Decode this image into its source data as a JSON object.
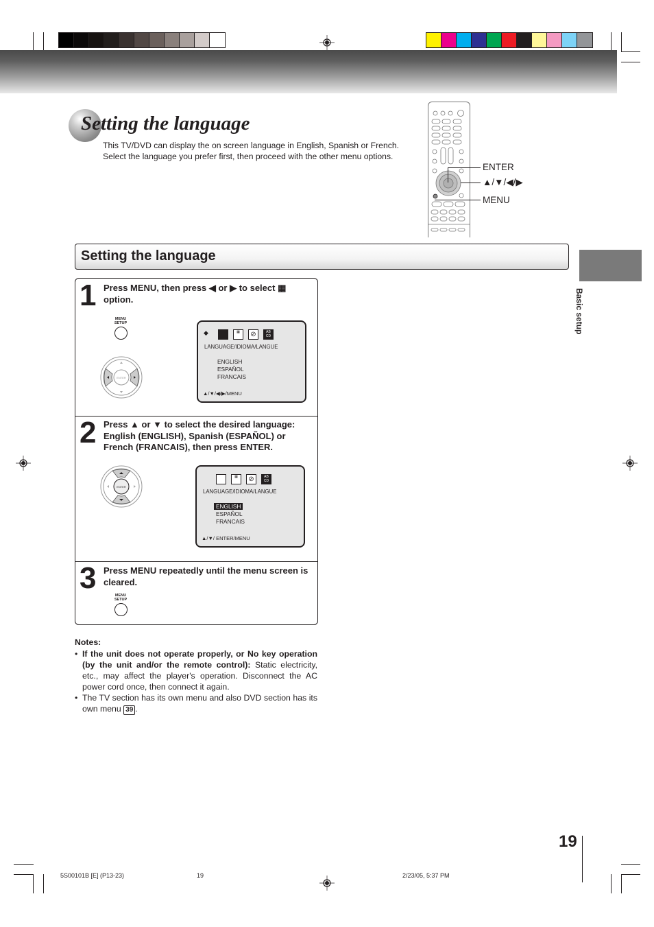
{
  "print_marks": {
    "grayscale_swatches": [
      "#000000",
      "#0b0909",
      "#171311",
      "#221e1c",
      "#3a3230",
      "#524845",
      "#6b605c",
      "#8a807c",
      "#a9a09d",
      "#d3cbc9",
      "#ffffff"
    ],
    "color_swatches": [
      "#fff200",
      "#ec008c",
      "#00aeef",
      "#2e3192",
      "#00a651",
      "#ed1c24",
      "#231f20",
      "#fff799",
      "#f49ac2",
      "#7dd3f7",
      "#939598"
    ]
  },
  "title": "Setting the language",
  "intro": "This TV/DVD can display the on screen language in English, Spanish or French. Select the language you prefer first, then proceed with the other menu options.",
  "remote": {
    "labels": {
      "enter": "ENTER",
      "arrows": "▲/▼/◀/▶",
      "menu": "MENU"
    }
  },
  "section_header": "Setting the language",
  "side_tab": "Basic setup",
  "steps": [
    {
      "number": "1",
      "text": "Press MENU, then press ◀ or ▶ to select ▦ option.",
      "button_label": "MENU SETUP",
      "osd": {
        "heading": "LANGUAGE/IDIOMA/LANGUE",
        "options": [
          "ENGLISH",
          "ESPAÑOL",
          "FRANCAIS"
        ],
        "selected": null,
        "footer": "▲/▼/◀/▶/MENU"
      }
    },
    {
      "number": "2",
      "text": "Press ▲ or ▼ to select the desired language: English (ENGLISH), Spanish (ESPAÑOL) or French (FRANCAIS), then press ENTER.",
      "osd": {
        "heading": "LANGUAGE/IDIOMA/LANGUE",
        "options": [
          "ENGLISH",
          "ESPAÑOL",
          "FRANCAIS"
        ],
        "selected": "ENGLISH",
        "footer": "▲/▼/ ENTER/MENU"
      }
    },
    {
      "number": "3",
      "text": "Press MENU repeatedly until the menu screen is cleared.",
      "button_label": "MENU SETUP"
    }
  ],
  "dpad": {
    "center_label": "ENTER"
  },
  "notes": {
    "heading": "Notes:",
    "items": [
      {
        "bold": "If the unit does not operate properly, or No key operation (by the unit and/or the remote control):",
        "text": " Static electricity, etc., may affect the player's operation. Disconnect the AC power cord once, then connect it again."
      },
      {
        "text": "The TV section has its own menu and also DVD section has its own menu ",
        "ref": "39",
        "after": "."
      }
    ]
  },
  "page_number": "19",
  "footer": {
    "job": "5S00101B [E] (P13-23)",
    "page": "19",
    "timestamp": "2/23/05, 5:37 PM"
  }
}
